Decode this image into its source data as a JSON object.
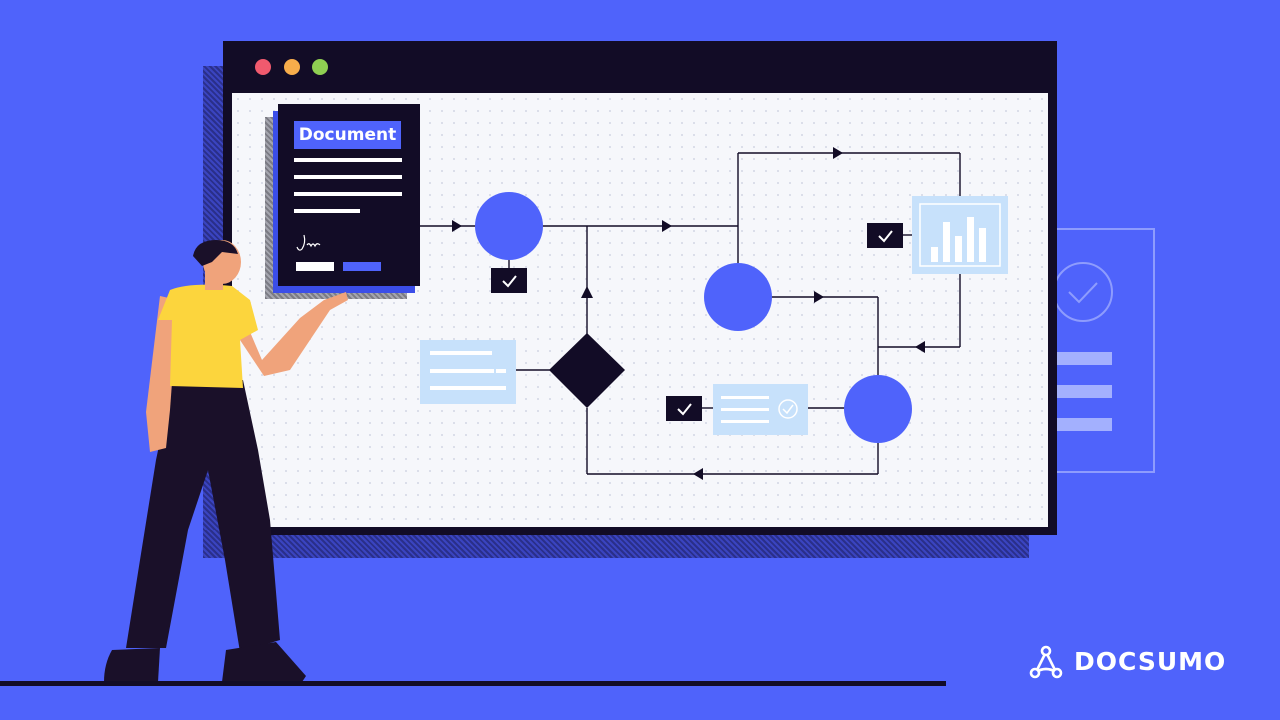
{
  "colors": {
    "background": "#4f63fb",
    "window_frame": "#120c26",
    "canvas": "#f6f7fb",
    "accent": "#4f63fb",
    "light_card": "#c7e1fb",
    "person_shirt": "#fcd53d",
    "person_pants": "#1a1029",
    "skin": "#f0a37b"
  },
  "window": {
    "controls": [
      "close-dot",
      "minimize-dot",
      "maximize-dot"
    ],
    "control_colors": [
      "#f05a6e",
      "#f7ad4b",
      "#8fcf52"
    ]
  },
  "document_card": {
    "title": "Document"
  },
  "brand": {
    "name": "DOCSUMO",
    "icon": "docsumo-logo-icon"
  },
  "icons": [
    "check-icon",
    "bar-chart-icon",
    "check-circle-icon",
    "signature-icon"
  ]
}
